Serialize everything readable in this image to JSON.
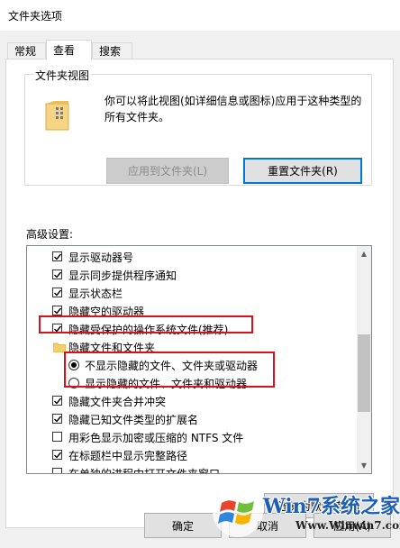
{
  "window": {
    "title": "文件夹选项"
  },
  "tabs": [
    {
      "label": "常规"
    },
    {
      "label": "查看"
    },
    {
      "label": "搜索"
    }
  ],
  "folder_views": {
    "group_title": "文件夹视图",
    "description": "你可以将此视图(如详细信息或图标)应用于这种类型的所有文件夹。",
    "apply_button": "应用到文件夹(L)",
    "reset_button": "重置文件夹(R)"
  },
  "advanced": {
    "label": "高级设置:",
    "items": [
      {
        "type": "checkbox",
        "label": "显示驱动器号",
        "checked": true
      },
      {
        "type": "checkbox",
        "label": "显示同步提供程序通知",
        "checked": true
      },
      {
        "type": "checkbox",
        "label": "显示状态栏",
        "checked": true
      },
      {
        "type": "checkbox",
        "label": "隐藏空的驱动器",
        "checked": true
      },
      {
        "type": "checkbox",
        "label": "隐藏受保护的操作系统文件(推荐)",
        "checked": true
      },
      {
        "type": "folder",
        "label": "隐藏文件和文件夹"
      },
      {
        "type": "radio",
        "label": "不显示隐藏的文件、文件夹或驱动器",
        "selected": true
      },
      {
        "type": "radio",
        "label": "显示隐藏的文件、文件夹和驱动器",
        "selected": false
      },
      {
        "type": "checkbox",
        "label": "隐藏文件夹合并冲突",
        "checked": true
      },
      {
        "type": "checkbox",
        "label": "隐藏已知文件类型的扩展名",
        "checked": true
      },
      {
        "type": "checkbox",
        "label": "用彩色显示加密或压缩的 NTFS 文件",
        "checked": false
      },
      {
        "type": "checkbox",
        "label": "在标题栏中显示完整路径",
        "checked": true
      },
      {
        "type": "checkbox",
        "label": "在单独的进程中打开文件夹窗口",
        "checked": false
      }
    ],
    "restore_button": "还原为默认值(D)"
  },
  "footer": {
    "ok_button": "确定",
    "cancel_button": "取消",
    "apply_button": "应用(A)"
  },
  "watermark": {
    "brand": "Win7系统之家",
    "url": "Www.Winwin7.com"
  },
  "colors": {
    "highlight_box": "#d9111a",
    "focus_border": "#0078d7",
    "watermark_blue": "#1d5fb8"
  }
}
